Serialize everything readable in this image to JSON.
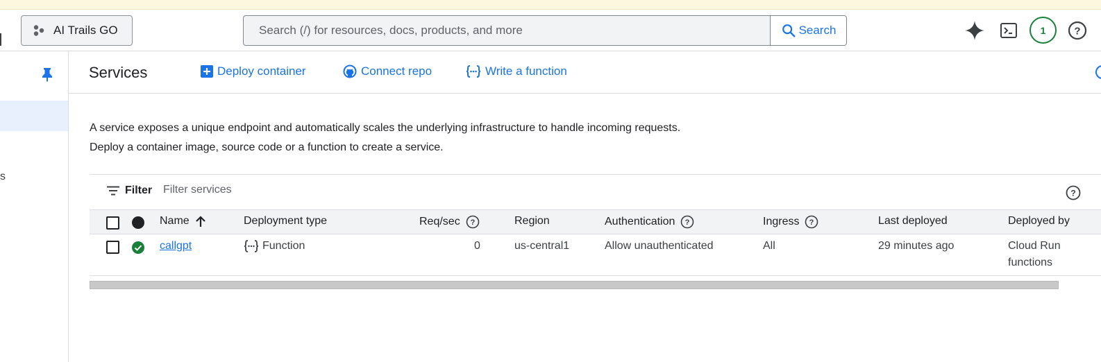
{
  "topbar": {
    "project_name": "AI Trails GO",
    "search_placeholder": "Search (/) for resources, docs, products, and more",
    "search_button_label": "Search",
    "notification_count": "1"
  },
  "header": {
    "title": "Services",
    "actions": [
      {
        "label": "Deploy container",
        "icon": "add-box-icon"
      },
      {
        "label": "Connect repo",
        "icon": "github-icon"
      },
      {
        "label": "Write a function",
        "icon": "function-icon"
      }
    ]
  },
  "leftnav": {
    "partial_label": "s"
  },
  "description": {
    "line1": "A service exposes a unique endpoint and automatically scales the underlying infrastructure to handle incoming requests.",
    "line2": "Deploy a container image, source code or a function to create a service."
  },
  "filter": {
    "label": "Filter",
    "placeholder": "Filter services"
  },
  "table": {
    "columns": [
      "Name",
      "Deployment type",
      "Req/sec",
      "Region",
      "Authentication",
      "Ingress",
      "Last deployed",
      "Deployed by"
    ],
    "rows": [
      {
        "name": "callgpt",
        "deployment_type": "Function",
        "req_sec": "0",
        "region": "us-central1",
        "authentication": "Allow unauthenticated",
        "ingress": "All",
        "last_deployed": "29 minutes ago",
        "deployed_by_line1": "Cloud Run",
        "deployed_by_line2": "functions"
      }
    ]
  },
  "colors": {
    "accent": "#1a73e8",
    "success": "#188038",
    "selected_nav": "#e8f0fe"
  }
}
